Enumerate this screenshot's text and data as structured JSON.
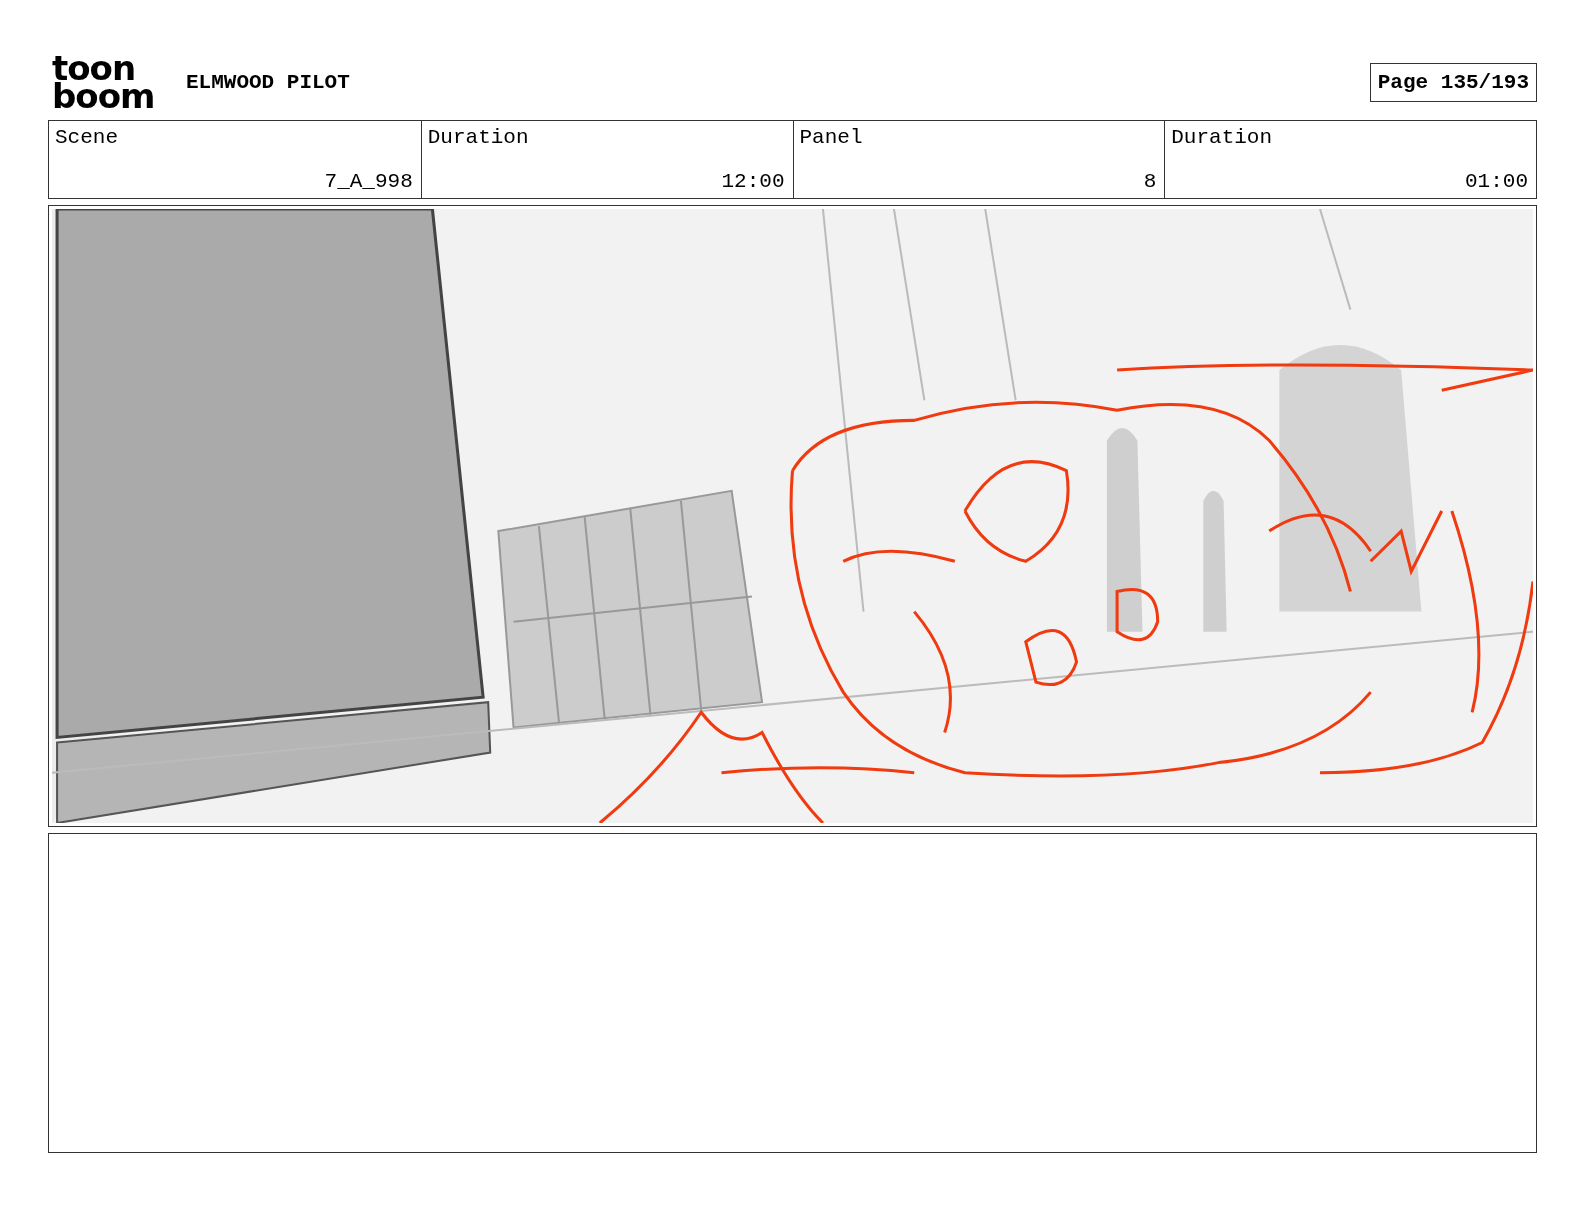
{
  "logo": {
    "top": "toon",
    "bottom": "boom"
  },
  "title": "ELMWOOD PILOT",
  "page": "Page 135/193",
  "info_table": {
    "columns": [
      "Scene",
      "Duration",
      "Panel",
      "Duration"
    ],
    "rows": [
      [
        "7_A_998",
        "12:00",
        "8",
        "01:00"
      ]
    ]
  }
}
